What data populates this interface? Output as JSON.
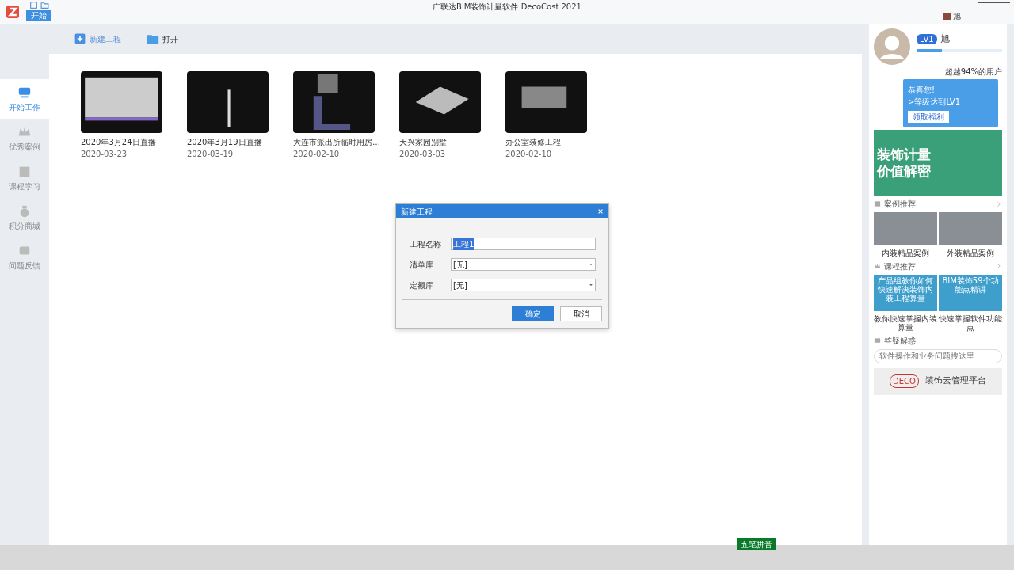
{
  "window": {
    "title": "广联达BIM装饰计量软件 DecoCost 2021",
    "user": "旭",
    "quick_tab": {
      "label": "开始",
      "selected": true
    }
  },
  "toolbar": [
    {
      "label": "新建工程",
      "kind": "new"
    },
    {
      "label": "打开",
      "kind": "open"
    }
  ],
  "sidebar": {
    "items": [
      {
        "label": "开始工作",
        "kind": "monitor",
        "selected": true
      },
      {
        "label": "优秀案例",
        "kind": "crown",
        "selected": false
      },
      {
        "label": "课程学习",
        "kind": "book",
        "selected": false
      },
      {
        "label": "积分商城",
        "kind": "bag",
        "selected": false
      },
      {
        "label": "问题反馈",
        "kind": "chat",
        "selected": false
      }
    ]
  },
  "projects": [
    {
      "name": "2020年3月24日直播",
      "date": "2020-03-23",
      "kind": "sheet"
    },
    {
      "name": "2020年3月19日直播",
      "date": "2020-03-19",
      "kind": "dots"
    },
    {
      "name": "大连市派出所临时用房…",
      "date": "2020-02-10",
      "kind": "plan"
    },
    {
      "name": "天兴家园别墅",
      "date": "2020-03-03",
      "kind": "house"
    },
    {
      "name": "办公室装修工程",
      "date": "2020-02-10",
      "kind": "box"
    }
  ],
  "dialog": {
    "title": "新建工程",
    "fields": [
      {
        "label": "工程名称",
        "kind": "text",
        "value": "工程1"
      },
      {
        "label": "清单库",
        "kind": "select",
        "value": "[无]"
      },
      {
        "label": "定额库",
        "kind": "select",
        "value": "[无]"
      }
    ],
    "buttons": [
      {
        "label": "确定",
        "primary": true
      },
      {
        "label": "取消",
        "primary": false
      }
    ]
  },
  "profile": {
    "level_badge": "LV1",
    "name": "旭",
    "level": 0.3,
    "rank_text": "超越94%的用户"
  },
  "popup": {
    "lines": [
      "恭喜您!",
      ">等级达到LV1"
    ],
    "button": "领取福利"
  },
  "banner": {
    "line1": "装饰计量",
    "line2": "价值解密"
  },
  "sections": [
    {
      "title": "案例推荐",
      "kind": "crown-less",
      "cards": [
        {
          "caption": "内装精品案例",
          "kind": "photo"
        },
        {
          "caption": "外装精品案例",
          "kind": "photo"
        }
      ]
    },
    {
      "title": "课程推荐",
      "kind": "crown",
      "cards": [
        {
          "caption": "教你快速掌握内装算量",
          "kind": "promo",
          "text": "产品组教你如何快速解决装饰内装工程算量"
        },
        {
          "caption": "快速掌握软件功能点",
          "kind": "promo",
          "text": "BIM装饰59个功能点精讲"
        }
      ]
    }
  ],
  "qa": {
    "title": "答疑解惑",
    "placeholder": "软件操作和业务问题搜这里"
  },
  "cloud": {
    "logo": "DECO",
    "label": "装饰云管理平台"
  },
  "ime": {
    "label": "五笔拼音"
  }
}
